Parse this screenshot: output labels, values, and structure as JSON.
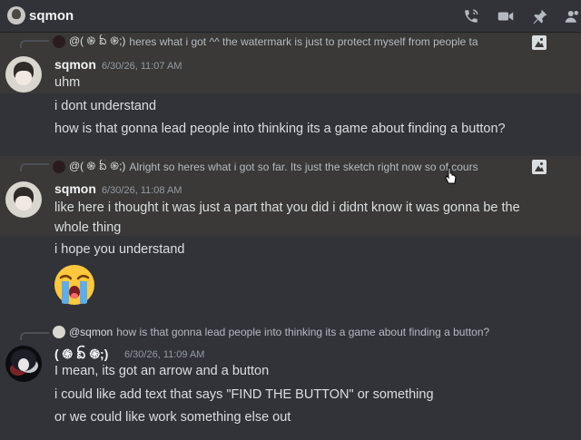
{
  "header": {
    "title": "sqmon",
    "icons": [
      "phone-call-icon",
      "video-call-icon",
      "pin-icon",
      "members-icon"
    ]
  },
  "messages": [
    {
      "reply": {
        "name": "@( ֍ ᨺ ֍;)",
        "text": "heres what i got ^^ the watermark is just to protect myself from people ta"
      },
      "author": "sqmon",
      "timestamp": "6/30/26, 11:07 AM",
      "lines": [
        "uhm",
        "i dont understand",
        "how is that gonna lead people into thinking its a game about finding a button?"
      ]
    },
    {
      "reply": {
        "name": "@( ֍ ᨺ ֍;)",
        "text": "Alright so heres what i got so far. Its just the sketch right now so of cours"
      },
      "author": "sqmon",
      "timestamp": "6/30/26, 11:08 AM",
      "lines": [
        "like here i thought it was just a part that you did i didnt know it was gonna be the whole thing",
        "i hope you understand"
      ],
      "emoji": "loudly-crying-face"
    },
    {
      "reply": {
        "name": "@sqmon",
        "text": "how is that gonna lead people into thinking its a game about finding a button?"
      },
      "author": "( ֍ ᨺ ֍;)",
      "timestamp": "6/30/26, 11:09 AM",
      "lines": [
        "I mean, its got an arrow and a button",
        "i could like add text that says \"FIND THE BUTTON\" or something",
        "or we could like work something else out"
      ]
    }
  ],
  "colors": {
    "background": "#313338",
    "highlight": "#3a3937",
    "text": "#dbdee1",
    "muted": "#949ba4"
  }
}
